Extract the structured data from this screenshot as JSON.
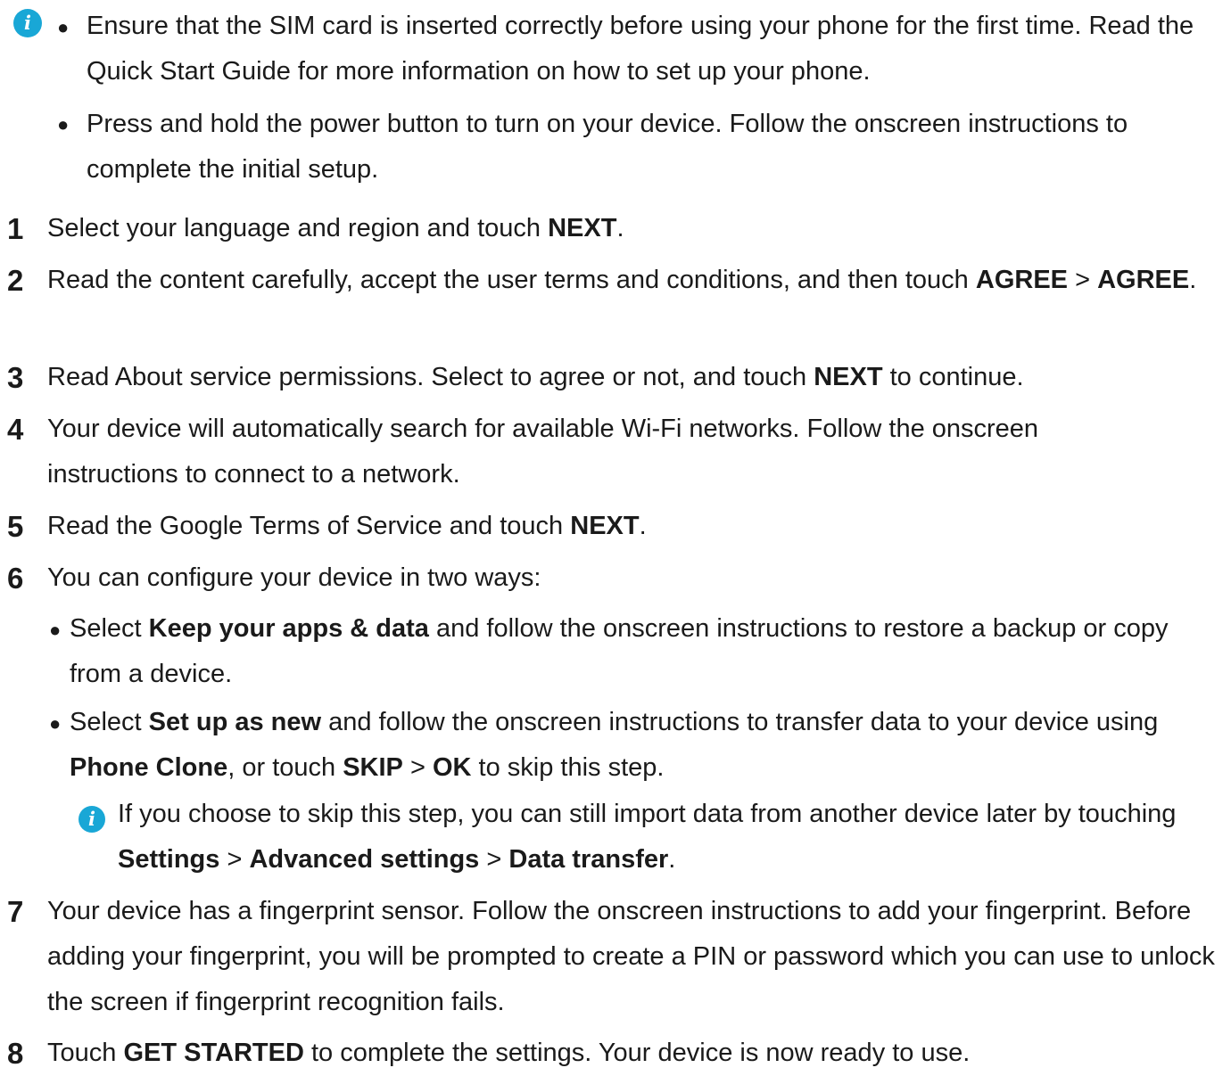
{
  "notes": [
    "Ensure that the SIM card is inserted correctly before using your phone for the first time. Read the Quick Start Guide for more information on how to set up your phone.",
    "Press and hold the power button to turn on your device. Follow the onscreen instructions to complete the initial setup."
  ],
  "steps": [
    {
      "num": "1",
      "parts": [
        [
          "Select your language and region and touch ",
          false
        ],
        [
          "NEXT",
          true
        ],
        [
          ".",
          false
        ]
      ]
    },
    {
      "num": "2",
      "parts": [
        [
          "Read the content carefully, accept the user terms and conditions, and then touch ",
          false
        ],
        [
          "AGREE",
          true
        ],
        [
          " > ",
          false
        ],
        [
          "AGREE",
          true
        ],
        [
          ".",
          false
        ]
      ]
    },
    {
      "num": "3",
      "parts": [
        [
          "Read About service permissions. Select to agree or not, and touch ",
          false
        ],
        [
          "NEXT",
          true
        ],
        [
          " to continue.",
          false
        ]
      ]
    },
    {
      "num": "4",
      "parts": [
        [
          "Your device will automatically search for available Wi-Fi networks. Follow the onscreen instructions to connect to a network.",
          false
        ]
      ]
    },
    {
      "num": "5",
      "parts": [
        [
          "Read the Google Terms of Service and touch ",
          false
        ],
        [
          "NEXT",
          true
        ],
        [
          ".",
          false
        ]
      ]
    },
    {
      "num": "6",
      "parts": [
        [
          "You can configure your device in two ways:",
          false
        ]
      ]
    },
    {
      "num": "7",
      "parts": [
        [
          "Your device has a fingerprint sensor. Follow the onscreen instructions to add your fingerprint. Before adding your fingerprint, you will be prompted to create a PIN or password which you can use to unlock the screen if fingerprint recognition fails.",
          false
        ]
      ]
    },
    {
      "num": "8",
      "parts": [
        [
          "Touch ",
          false
        ],
        [
          "GET STARTED",
          true
        ],
        [
          " to complete the settings. Your device is now ready to use.",
          false
        ]
      ]
    }
  ],
  "step6_options": [
    {
      "parts": [
        [
          "Select ",
          false
        ],
        [
          "Keep your apps & data",
          true
        ],
        [
          " and follow the onscreen instructions to restore a backup or copy from a device.",
          false
        ]
      ]
    },
    {
      "parts": [
        [
          "Select ",
          false
        ],
        [
          "Set up as new",
          true
        ],
        [
          " and follow the onscreen instructions to transfer data to your device using ",
          false
        ],
        [
          "Phone Clone",
          true
        ],
        [
          ", or touch ",
          false
        ],
        [
          "SKIP",
          true
        ],
        [
          " > ",
          false
        ],
        [
          "OK",
          true
        ],
        [
          " to skip this step.",
          false
        ]
      ]
    }
  ],
  "step6_tip": {
    "parts": [
      [
        "If you choose to skip this step, you can still import data from another device later by touching ",
        false
      ],
      [
        "Settings",
        true
      ],
      [
        " > ",
        false
      ],
      [
        "Advanced settings",
        true
      ],
      [
        " > ",
        false
      ],
      [
        "Data transfer",
        true
      ],
      [
        ".",
        false
      ]
    ]
  },
  "icons": {
    "info": "info-icon",
    "color": "#19a7d6"
  }
}
